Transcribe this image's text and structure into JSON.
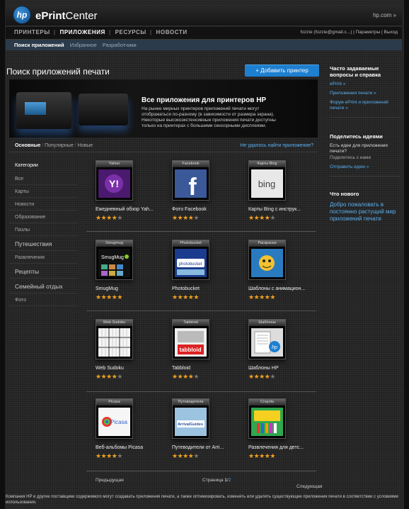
{
  "header": {
    "logo_text": "hp",
    "brand_prefix": "ePrint",
    "brand_suffix": "Center",
    "hp_com": "hp.com »"
  },
  "nav": {
    "items": [
      "ПРИНТЕРЫ",
      "ПРИЛОЖЕНИЯ",
      "РЕСУРСЫ",
      "НОВОСТИ"
    ],
    "active_index": 1,
    "user_text": "fozzie (fozzie@gmail.c...)  |  Параметры  |  Выход"
  },
  "subnav": {
    "items": [
      "Поиск приложений",
      "Избранное",
      "Разработчики"
    ]
  },
  "main": {
    "title": "Поиск приложений печати",
    "add_printer_label": "+ Добавить принтер",
    "hero_title": "Все приложения для принтеров HP",
    "hero_text": "На рынке мирных принтеров приложений печати могут отображаться по-разному (в зависимости от размера экрана). Некоторые высокоэкстенсивные приложения печати доступны только на принтерах с большими сенсорными дисплеями.",
    "tabs": [
      "Основные",
      "Популярные",
      "Новые"
    ],
    "not_found_link": "Не удалось найти приложение?"
  },
  "categories": {
    "title": "Категории",
    "items": [
      "Все",
      "Карты",
      "Новости",
      "Образование",
      "Пазлы",
      "Путешествия",
      "Развлечения",
      "Рецепты",
      "Семейный отдых",
      "Фото"
    ]
  },
  "apps": [
    {
      "label": "Yahoo",
      "name": "Ежедневный обзор Yah...",
      "rating": 4,
      "icon": "yahoo-icon"
    },
    {
      "label": "Facebook",
      "name": "Фото Facebook",
      "rating": 4,
      "icon": "facebook-icon"
    },
    {
      "label": "Карты Bing",
      "name": "Карты Bing с инструк...",
      "rating": 4,
      "icon": "bing-icon"
    },
    {
      "label": "Smugmug",
      "name": "SmugMug",
      "rating": 5,
      "icon": "smugmug-icon"
    },
    {
      "label": "Photobucket",
      "name": "Photobucket",
      "rating": 5,
      "icon": "photobucket-icon"
    },
    {
      "label": "Раскраски",
      "name": "Шаблоны с анимацион...",
      "rating": 5,
      "icon": "coloring-icon"
    },
    {
      "label": "Web Sudoku",
      "name": "Web Sudoku",
      "rating": 4,
      "icon": "sudoku-icon"
    },
    {
      "label": "Tabbloid",
      "name": "Tabbloid",
      "rating": 4,
      "icon": "tabbloid-icon"
    },
    {
      "label": "Шаблоны",
      "name": "Шаблоны HP",
      "rating": 4,
      "icon": "templates-icon"
    },
    {
      "label": "Picasa",
      "name": "Веб-альбомы Picasa",
      "rating": 4,
      "icon": "picasa-icon"
    },
    {
      "label": "Путеводители",
      "name": "Путеводители от Arri...",
      "rating": 4,
      "icon": "travel-icon"
    },
    {
      "label": "Crayola",
      "name": "Развлечения для детс...",
      "rating": 5,
      "icon": "crayola-icon"
    }
  ],
  "pager": {
    "prev": "Предыдущая",
    "page_label": "Страница",
    "current": "1",
    "separator": "/",
    "next_page": "2",
    "next": "Следующая"
  },
  "sidebar": {
    "faq_title": "Часто задаваемые вопросы и справка",
    "faq_links": [
      "ePrint »",
      "Приложения печати »",
      "Форум ePrint и приложений печати »"
    ],
    "ideas_title": "Поделитесь идеями",
    "ideas_question": "Есть идеи для приложения печати?",
    "ideas_text": "Поделитесь с нами",
    "ideas_link": "Отправить идею »",
    "news_title": "Что нового",
    "news_link": "Добро пожаловать в постоянно растущий мир приложений печати"
  },
  "footer": {
    "text": "Компания HP и другие поставщики содержимого могут создавать приложения печати, а также оптимизировать, изменять или удалять существующие приложения печати в соответствии с условиями использования."
  },
  "colors": {
    "accent": "#1d7fd0",
    "link": "#5ab0f0",
    "star": "#f0a020"
  }
}
